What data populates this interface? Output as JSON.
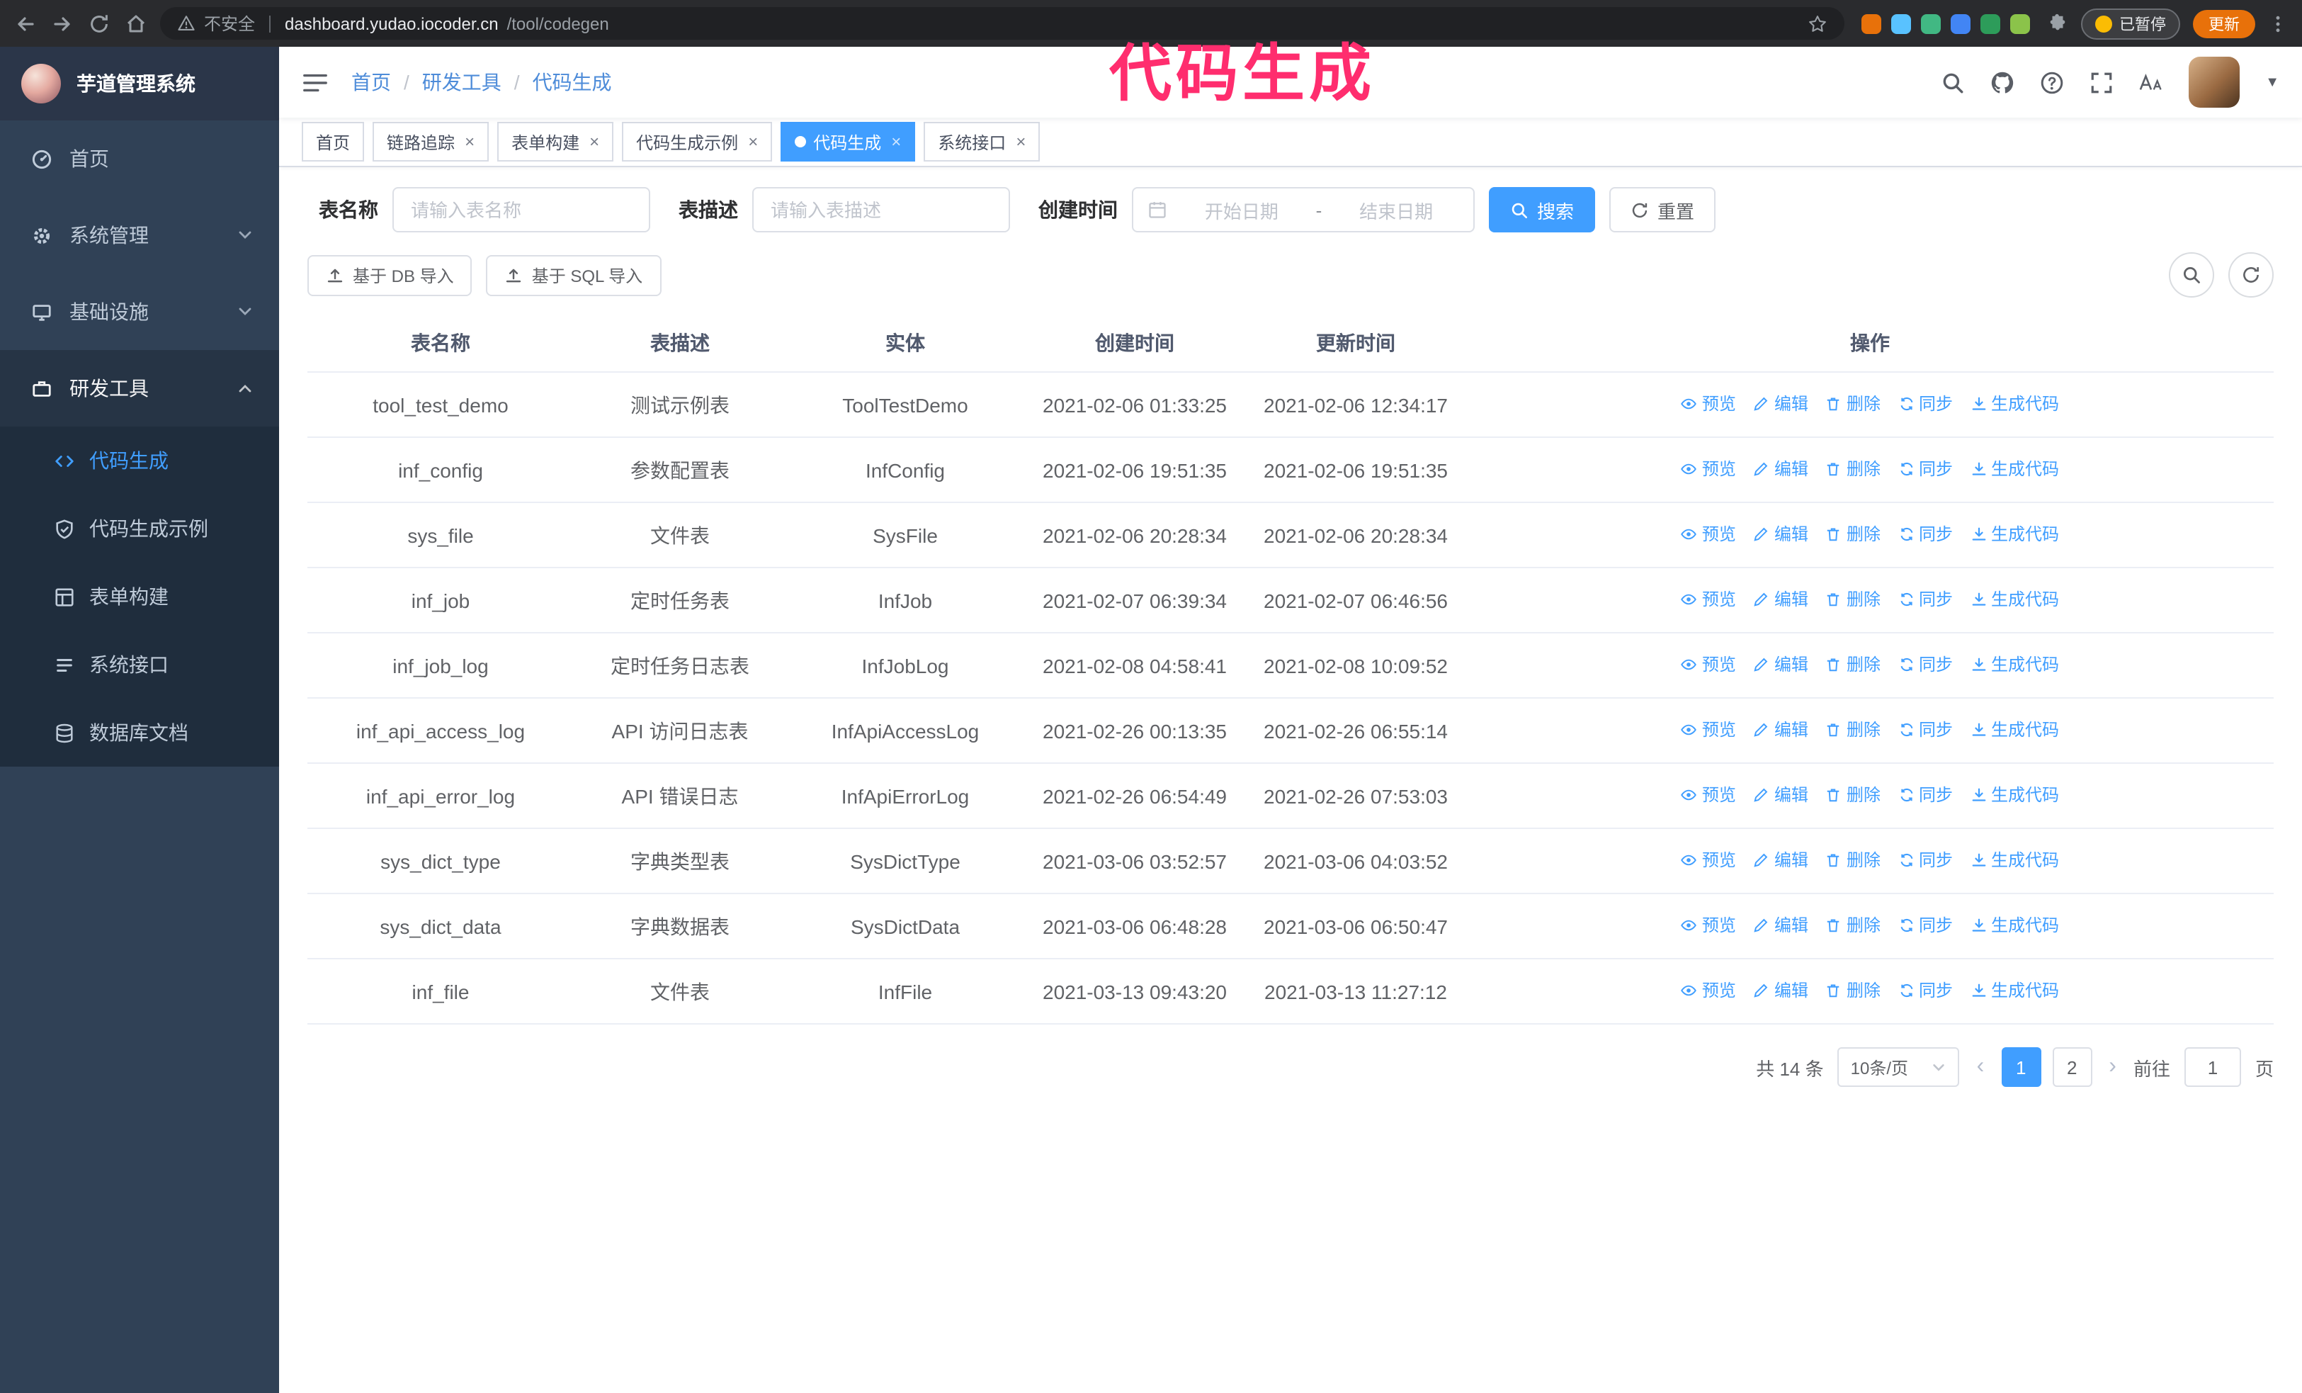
{
  "browser": {
    "security_label": "不安全",
    "url_host": "dashboard.yudao.iocoder.cn",
    "url_path": "/tool/codegen",
    "paused_badge": "已暂停",
    "update_button": "更新",
    "nav_icons": [
      "back-icon",
      "forward-icon",
      "reload-icon",
      "home-icon"
    ],
    "extensions": [
      "#e8710a",
      "#59c2ff",
      "#41b883",
      "#4285f4",
      "#2d9c5a",
      "#8bc34a"
    ]
  },
  "annotation": {
    "text": "代码生成",
    "color": "#ff2d6e"
  },
  "colors": {
    "primary": "#409eff",
    "sidebar_bg": "#304156",
    "submenu_bg": "#1f2d3d"
  },
  "sidebar": {
    "logo_title": "芋道管理系统",
    "menu": [
      {
        "id": "home",
        "label": "首页",
        "icon": "dashboard-icon"
      },
      {
        "id": "system",
        "label": "系统管理",
        "icon": "gear-icon",
        "collapsible": true
      },
      {
        "id": "infra",
        "label": "基础设施",
        "icon": "infra-icon",
        "collapsible": true
      },
      {
        "id": "dev-tools",
        "label": "研发工具",
        "icon": "tools-icon",
        "collapsible": true,
        "expanded": true,
        "children": [
          {
            "id": "codegen",
            "label": "代码生成",
            "icon": "code-icon",
            "active": true
          },
          {
            "id": "codegen-example",
            "label": "代码生成示例",
            "icon": "example-icon"
          },
          {
            "id": "form-builder",
            "label": "表单构建",
            "icon": "form-icon"
          },
          {
            "id": "system-api",
            "label": "系统接口",
            "icon": "api-icon"
          },
          {
            "id": "db-doc",
            "label": "数据库文档",
            "icon": "db-icon"
          }
        ]
      }
    ]
  },
  "header": {
    "breadcrumb": [
      "首页",
      "研发工具",
      "代码生成"
    ],
    "icons": [
      "search-icon",
      "github-icon",
      "question-icon",
      "fullscreen-icon",
      "font-size-icon"
    ]
  },
  "tabs": [
    {
      "id": "home",
      "label": "首页",
      "closable": false
    },
    {
      "id": "trace",
      "label": "链路追踪",
      "closable": true
    },
    {
      "id": "form-builder",
      "label": "表单构建",
      "closable": true
    },
    {
      "id": "codegen-example",
      "label": "代码生成示例",
      "closable": true
    },
    {
      "id": "codegen",
      "label": "代码生成",
      "closable": true,
      "active": true
    },
    {
      "id": "system-api",
      "label": "系统接口",
      "closable": true
    }
  ],
  "filter": {
    "table_name_label": "表名称",
    "table_name_placeholder": "请输入表名称",
    "table_desc_label": "表描述",
    "table_desc_placeholder": "请输入表描述",
    "create_time_label": "创建时间",
    "date_start_placeholder": "开始日期",
    "date_separator": "-",
    "date_end_placeholder": "结束日期",
    "search_button": "搜索",
    "reset_button": "重置"
  },
  "toolbar": {
    "import_db": "基于 DB 导入",
    "import_sql": "基于 SQL 导入"
  },
  "table": {
    "columns": [
      "表名称",
      "表描述",
      "实体",
      "创建时间",
      "更新时间",
      "操作"
    ],
    "actions": [
      "预览",
      "编辑",
      "删除",
      "同步",
      "生成代码"
    ],
    "action_ids": [
      "preview",
      "edit",
      "delete",
      "sync",
      "generate-code"
    ],
    "action_icons": [
      "eye-icon",
      "edit-icon",
      "delete-icon",
      "sync-icon",
      "download-icon"
    ],
    "rows": [
      {
        "name": "tool_test_demo",
        "desc": "测试示例表",
        "entity": "ToolTestDemo",
        "created": "2021-02-06 01:33:25",
        "updated": "2021-02-06 12:34:17"
      },
      {
        "name": "inf_config",
        "desc": "参数配置表",
        "entity": "InfConfig",
        "created": "2021-02-06 19:51:35",
        "updated": "2021-02-06 19:51:35"
      },
      {
        "name": "sys_file",
        "desc": "文件表",
        "entity": "SysFile",
        "created": "2021-02-06 20:28:34",
        "updated": "2021-02-06 20:28:34"
      },
      {
        "name": "inf_job",
        "desc": "定时任务表",
        "entity": "InfJob",
        "created": "2021-02-07 06:39:34",
        "updated": "2021-02-07 06:46:56"
      },
      {
        "name": "inf_job_log",
        "desc": "定时任务日志表",
        "entity": "InfJobLog",
        "created": "2021-02-08 04:58:41",
        "updated": "2021-02-08 10:09:52"
      },
      {
        "name": "inf_api_access_log",
        "desc": "API 访问日志表",
        "entity": "InfApiAccessLog",
        "created": "2021-02-26 00:13:35",
        "updated": "2021-02-26 06:55:14"
      },
      {
        "name": "inf_api_error_log",
        "desc": "API 错误日志",
        "entity": "InfApiErrorLog",
        "created": "2021-02-26 06:54:49",
        "updated": "2021-02-26 07:53:03"
      },
      {
        "name": "sys_dict_type",
        "desc": "字典类型表",
        "entity": "SysDictType",
        "created": "2021-03-06 03:52:57",
        "updated": "2021-03-06 04:03:52"
      },
      {
        "name": "sys_dict_data",
        "desc": "字典数据表",
        "entity": "SysDictData",
        "created": "2021-03-06 06:48:28",
        "updated": "2021-03-06 06:50:47"
      },
      {
        "name": "inf_file",
        "desc": "文件表",
        "entity": "InfFile",
        "created": "2021-03-13 09:43:20",
        "updated": "2021-03-13 11:27:12"
      }
    ]
  },
  "pagination": {
    "total": "共 14 条",
    "page_size": "10条/页",
    "prev": "‹",
    "next": "›",
    "pages": [
      "1",
      "2"
    ],
    "active_page": "1",
    "goto_label": "前往",
    "goto_value": "1",
    "goto_suffix": "页"
  }
}
